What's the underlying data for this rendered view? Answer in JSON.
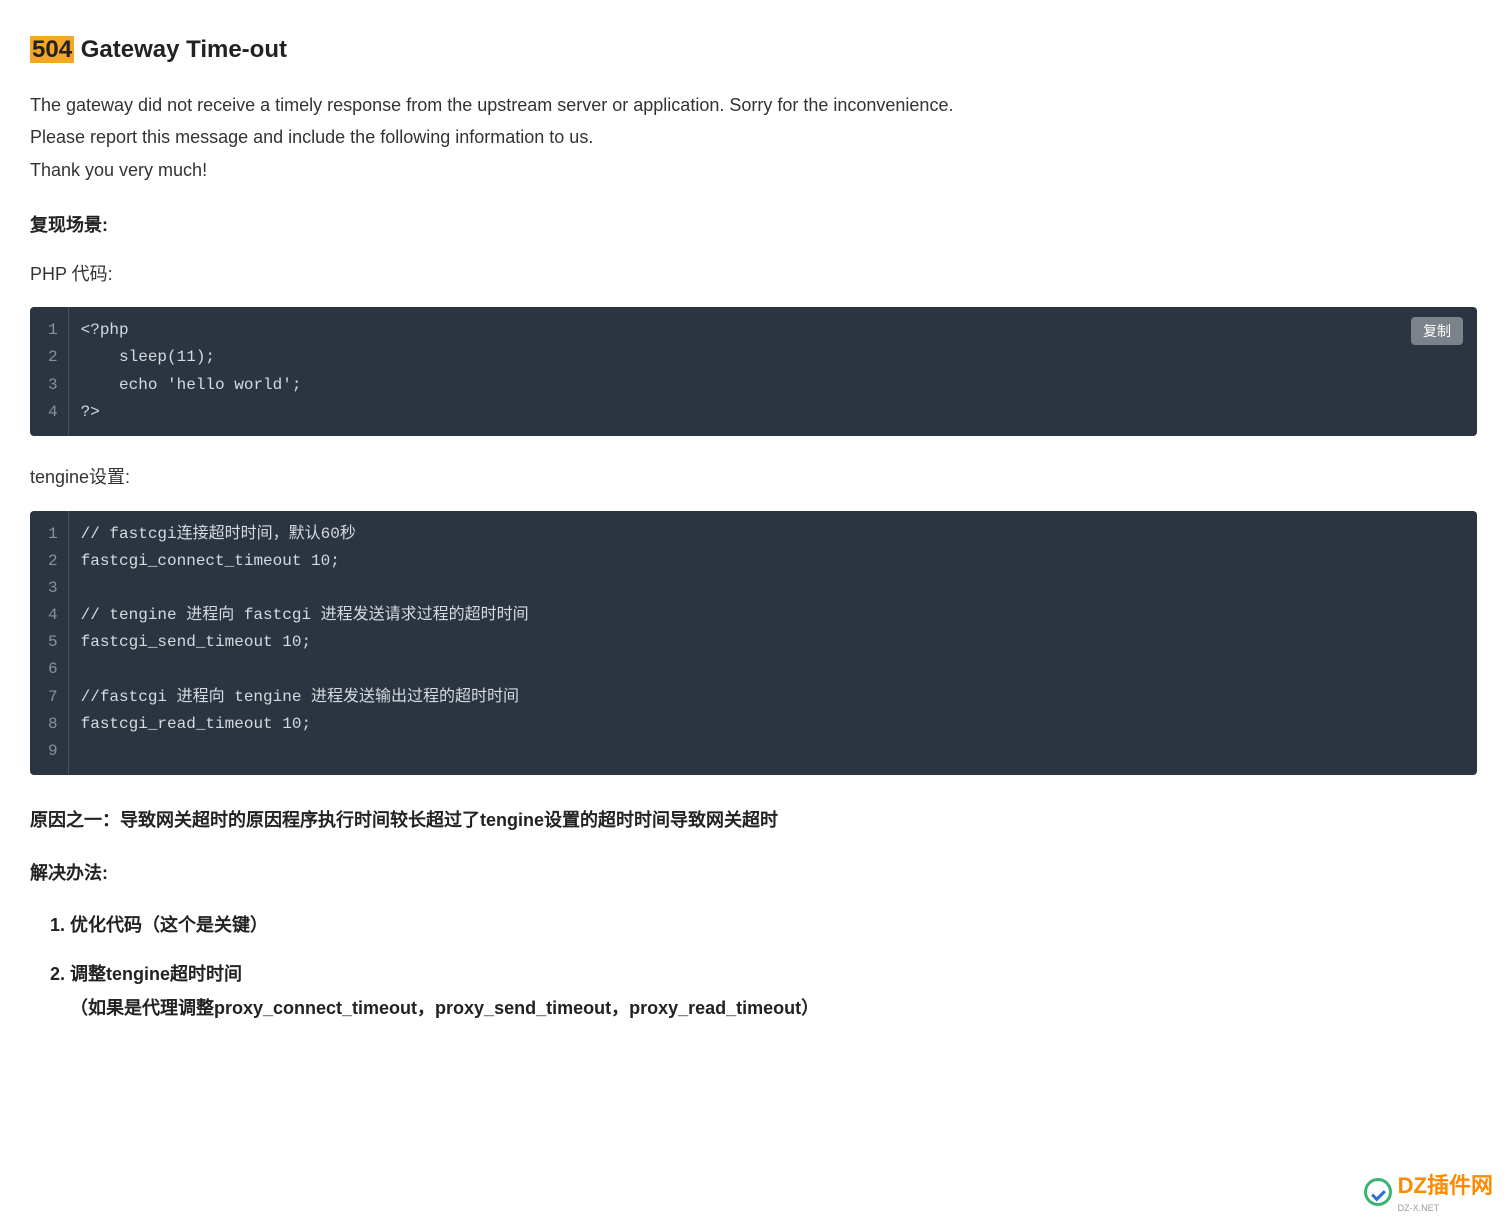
{
  "title": {
    "highlight": "504",
    "rest": " Gateway Time-out"
  },
  "intro": {
    "line1": "The gateway did not receive a timely response from the upstream server or application. Sorry for the inconvenience.",
    "line2": "Please report this message and include the following information to us.",
    "line3": "Thank you very much!"
  },
  "labels": {
    "scenario": "复现场景:",
    "php": "PHP 代码:",
    "tengine": "tengine设置:",
    "cause": "原因之一：导致网关超时的原因程序执行时间较长超过了tengine设置的超时时间导致网关超时",
    "solve": "解决办法:",
    "copy": "复制"
  },
  "code1": {
    "lines": [
      "<?php",
      "    sleep(11);",
      "    echo 'hello world';",
      "?>"
    ]
  },
  "code2": {
    "lines": [
      "// fastcgi连接超时时间，默认60秒",
      "fastcgi_connect_timeout 10;",
      "",
      "// tengine 进程向 fastcgi 进程发送请求过程的超时时间",
      "fastcgi_send_timeout 10;",
      "",
      "//fastcgi 进程向 tengine 进程发送输出过程的超时时间",
      "fastcgi_read_timeout 10;",
      ""
    ]
  },
  "solutions": {
    "item1": "优化代码（这个是关键）",
    "item2": "调整tengine超时时间",
    "item2sub": "（如果是代理调整proxy_connect_timeout，proxy_send_timeout，proxy_read_timeout）"
  },
  "watermark": {
    "text": "DZ插件网",
    "sub": "DZ-X.NET"
  }
}
